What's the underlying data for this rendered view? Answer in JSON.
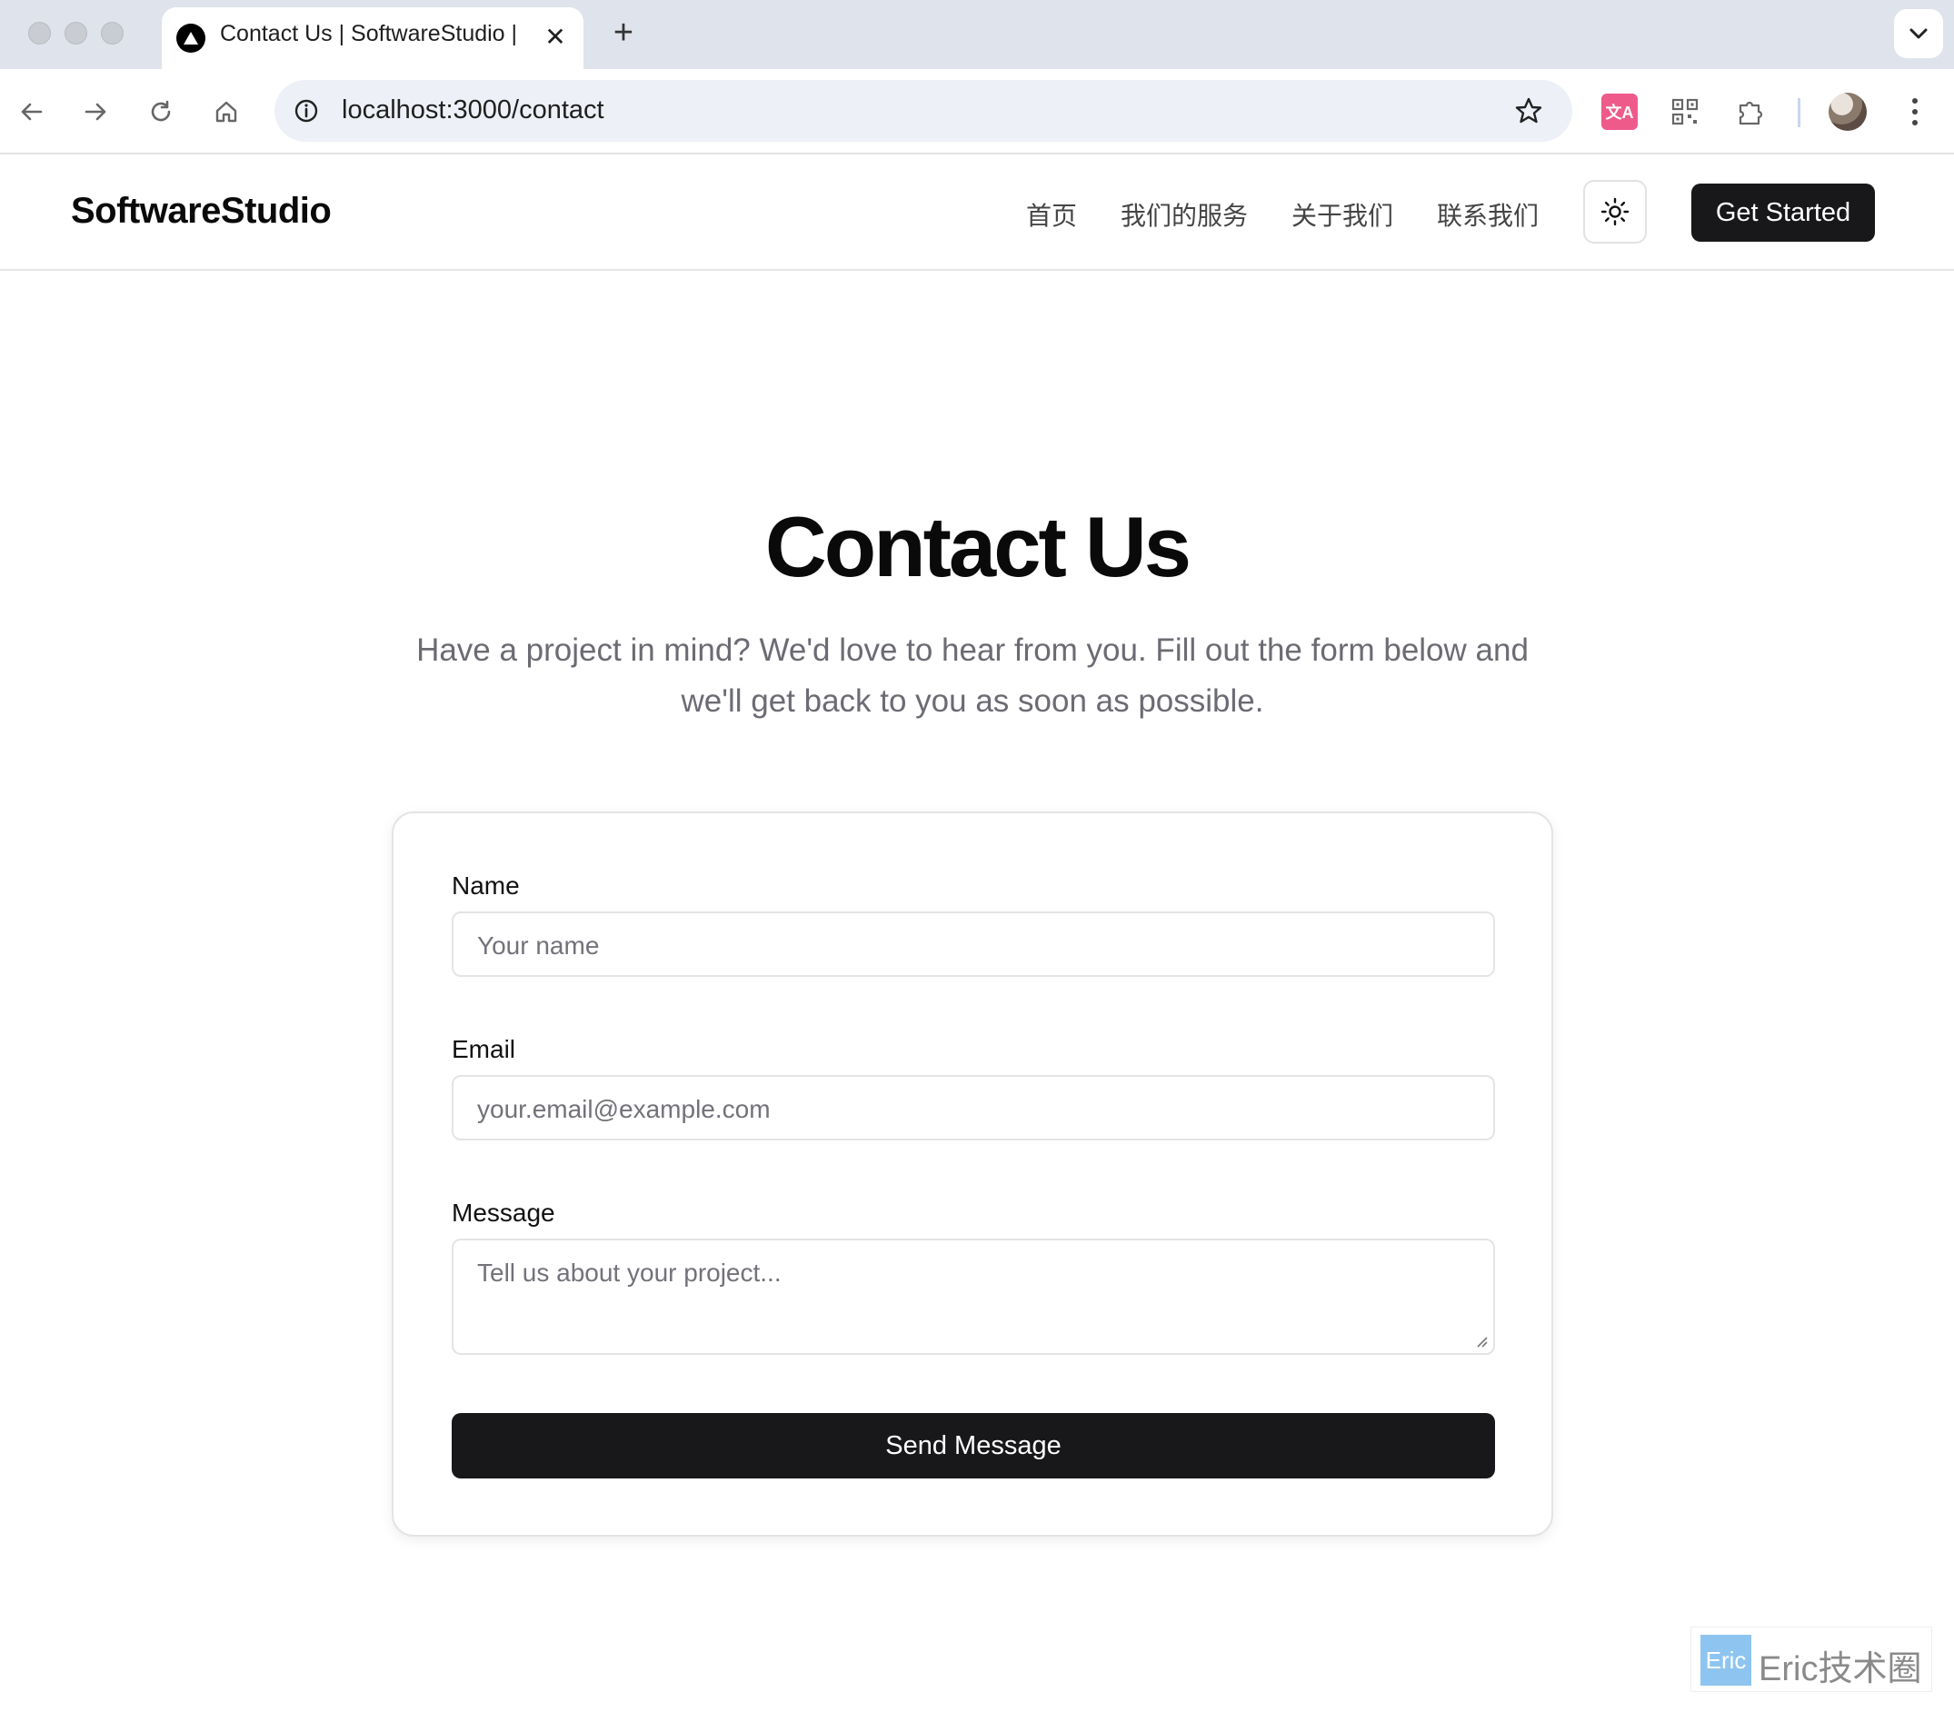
{
  "browser": {
    "tab_title": "Contact Us | SoftwareStudio |",
    "tab_close": "✕",
    "new_tab": "+",
    "url": "localhost:3000/contact",
    "extension_translate_label": "文A"
  },
  "site": {
    "logo": "SoftwareStudio",
    "nav": [
      "首页",
      "我们的服务",
      "关于我们",
      "联系我们"
    ],
    "cta_label": "Get Started",
    "icons": {
      "theme_toggle": "sun-icon"
    }
  },
  "hero": {
    "title": "Contact Us",
    "subtitle_line1": "Have a project in mind? We'd love to hear from you. Fill out the form below and",
    "subtitle_line2": "we'll get back to you as soon as possible."
  },
  "form": {
    "name_label": "Name",
    "name_placeholder": "Your name",
    "email_label": "Email",
    "email_placeholder": "your.email@example.com",
    "message_label": "Message",
    "message_placeholder": "Tell us about your project...",
    "submit_label": "Send Message"
  },
  "watermark": {
    "badge": "Eric",
    "text": "Eric技术圈"
  },
  "colors": {
    "primary_button": "#18181b",
    "muted_text": "#6b6b73",
    "border": "#e4e4e7"
  }
}
